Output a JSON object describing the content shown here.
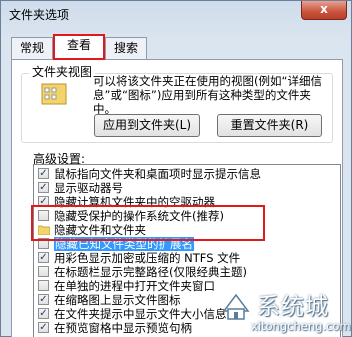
{
  "window": {
    "title": "文件夹选项",
    "close_label": "x"
  },
  "tabs": [
    {
      "label": "常规"
    },
    {
      "label": "查看"
    },
    {
      "label": "搜索"
    }
  ],
  "folder_view": {
    "group_label": "文件夹视图",
    "description": "可以将该文件夹正在使用的视图(例如“详细信息”或“图标”)应用到所有这种类型的文件夹中。",
    "apply_button": "应用到文件夹(L)",
    "reset_button": "重置文件夹(R)"
  },
  "advanced": {
    "label": "高级设置:",
    "rows": [
      {
        "text": "鼠标指向文件夹和桌面项时显示提示信息",
        "checked": true
      },
      {
        "text": "显示驱动器号",
        "checked": true
      },
      {
        "text": "隐藏计算机文件夹中的空驱动器",
        "checked": true
      },
      {
        "text": "隐藏受保护的操作系统文件(推荐)",
        "checked": false
      },
      {
        "text": "隐藏文件和文件夹",
        "checked": null
      },
      {
        "text": "隐藏已知文件类型的扩展名",
        "checked": false
      },
      {
        "text": "用彩色显示加密或压缩的 NTFS 文件",
        "checked": true
      },
      {
        "text": "在标题栏显示完整路径(仅限经典主题)",
        "checked": false
      },
      {
        "text": "在单独的进程中打开文件夹窗口",
        "checked": false
      },
      {
        "text": "在缩略图上显示文件图标",
        "checked": true
      },
      {
        "text": "在文件夹提示中显示文件大小信息",
        "checked": true
      },
      {
        "text": "在预览窗格中显示预览句柄",
        "checked": true
      }
    ]
  },
  "watermark": {
    "brand": "系统城",
    "domain": "xitongcheng.com"
  },
  "colors": {
    "highlight": "#e0191b",
    "selection": "#3399ff"
  }
}
